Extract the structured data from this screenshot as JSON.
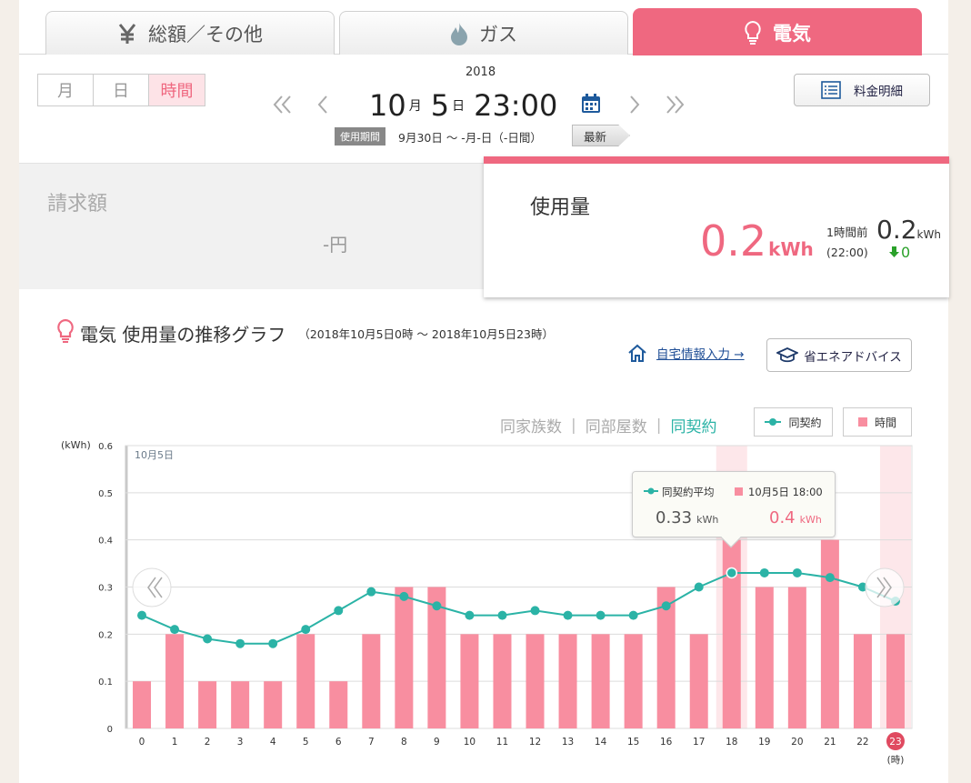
{
  "tabs": [
    {
      "label": "総額／その他",
      "icon": "yen-icon"
    },
    {
      "label": "ガス",
      "icon": "flame-icon"
    },
    {
      "label": "電気",
      "icon": "lightbulb-icon"
    }
  ],
  "modes": [
    "月",
    "日",
    "時間"
  ],
  "date": {
    "year": "2018",
    "month": "10",
    "month_unit": "月",
    "day": "5",
    "day_unit": "日",
    "time": "23:00"
  },
  "period": {
    "label": "使用期間",
    "text": "9月30日 〜 -月-日（-日間）"
  },
  "latest_label": "最新",
  "bill_button": "料金明細",
  "bill": {
    "title": "請求額",
    "value": "-円"
  },
  "usage": {
    "title": "使用量",
    "value": "0.2",
    "unit": "kWh",
    "prev_label_1": "1時間前",
    "prev_label_2": "(22:00)",
    "prev_value": "0.2",
    "prev_unit": "kWh",
    "diff": "0"
  },
  "graph": {
    "title": "電気 使用量の推移グラフ",
    "range": "（2018年10月5日0時 〜 2018年10月5日23時）",
    "home_link": "自宅情報入力 →",
    "advice_button": "省エネアドバイス"
  },
  "filters": {
    "family": "同家族数",
    "rooms": "同部屋数",
    "contract": "同契約",
    "sep": "|"
  },
  "legend": {
    "line": "同契約",
    "bar": "時間"
  },
  "tooltip": {
    "avg_label": "同契約平均",
    "date_label": "10月5日 18:00",
    "avg_value": "0.33",
    "bar_value": "0.4",
    "unit": "kWh"
  },
  "colors": {
    "accent": "#ef6880",
    "teal": "#2bb3a6",
    "bar": "#f88ea0"
  },
  "chart_data": {
    "type": "bar",
    "ylabel": "(kWh)",
    "xlabel": "(時)",
    "date_label": "10月5日",
    "ylim": [
      0,
      0.6
    ],
    "yticks": [
      0,
      0.1,
      0.2,
      0.3,
      0.4,
      0.5,
      0.6
    ],
    "categories": [
      "0",
      "1",
      "2",
      "3",
      "4",
      "5",
      "6",
      "7",
      "8",
      "9",
      "10",
      "11",
      "12",
      "13",
      "14",
      "15",
      "16",
      "17",
      "18",
      "19",
      "20",
      "21",
      "22",
      "23"
    ],
    "series": [
      {
        "name": "時間",
        "type": "bar",
        "values": [
          0.1,
          0.2,
          0.1,
          0.1,
          0.1,
          0.2,
          0.1,
          0.2,
          0.3,
          0.3,
          0.2,
          0.2,
          0.2,
          0.2,
          0.2,
          0.2,
          0.3,
          0.2,
          0.4,
          0.3,
          0.3,
          0.4,
          0.2,
          0.2
        ]
      },
      {
        "name": "同契約",
        "type": "line",
        "values": [
          0.24,
          0.21,
          0.19,
          0.18,
          0.18,
          0.21,
          0.25,
          0.29,
          0.28,
          0.26,
          0.24,
          0.24,
          0.25,
          0.24,
          0.24,
          0.24,
          0.26,
          0.3,
          0.33,
          0.33,
          0.33,
          0.32,
          0.3,
          0.27
        ]
      }
    ],
    "highlighted_x": [
      "18",
      "23"
    ],
    "grid": true
  }
}
